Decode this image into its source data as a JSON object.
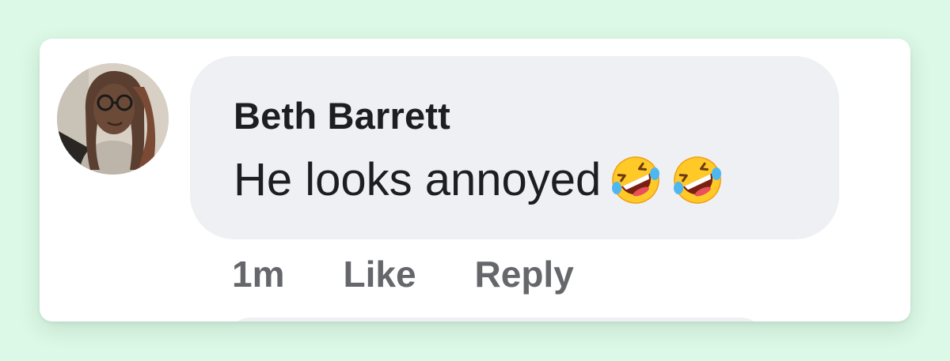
{
  "comment": {
    "author": "Beth Barrett",
    "text": "He looks annoyed",
    "emojis": [
      "rolling-on-floor-laughing-emoji",
      "rolling-on-floor-laughing-emoji"
    ],
    "timestamp": "1m",
    "like_label": "Like",
    "reply_label": "Reply"
  },
  "colors": {
    "page_background": "#dcf8e6",
    "card_background": "#ffffff",
    "bubble_background": "#eff0f4",
    "primary_text": "#1c1e21",
    "secondary_text": "#65676b"
  }
}
